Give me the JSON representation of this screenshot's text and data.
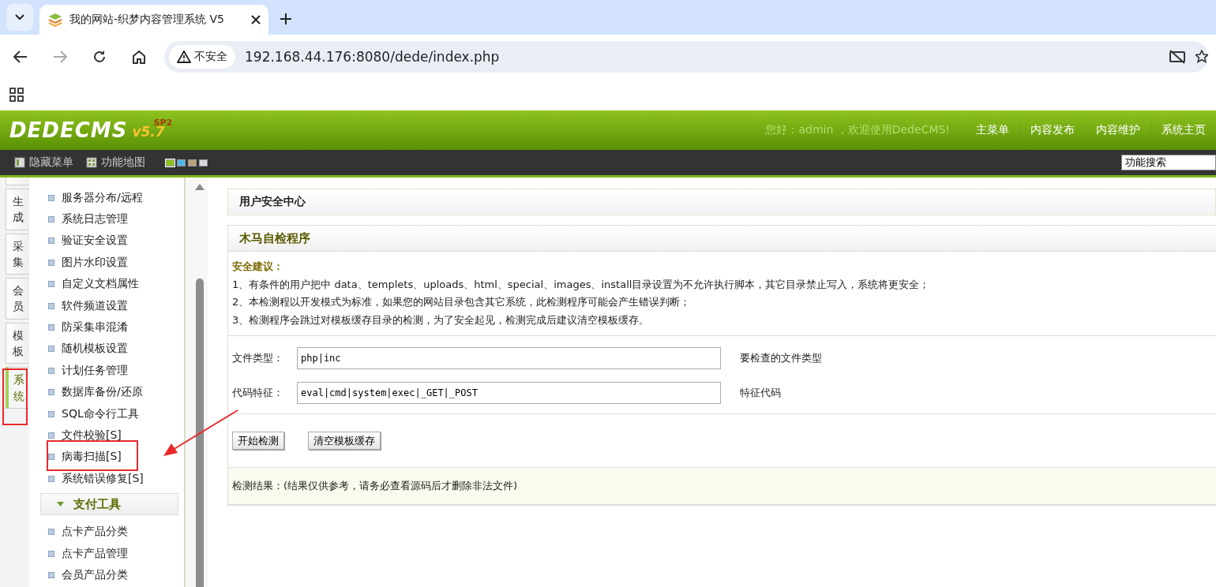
{
  "browser": {
    "tab_title": "我的网站-织梦内容管理系统 V5",
    "security": "不安全",
    "url": "192.168.44.176:8080/dede/index.php"
  },
  "header": {
    "logo": "DEDECMS",
    "version": "v5.7",
    "edition": "SP2",
    "greeting": "您好：admin ，欢迎使用DedeCMS!",
    "nav": [
      "主菜单",
      "内容发布",
      "内容维护",
      "系统主页"
    ]
  },
  "toolbar": {
    "items": [
      "隐藏菜单",
      "功能地图"
    ],
    "skins": [
      {
        "color": "#8fc31f",
        "selected": true
      },
      {
        "color": "#4fb6e3",
        "selected": false
      },
      {
        "color": "#b8a27c",
        "selected": false
      },
      {
        "color": "#d6d9dc",
        "selected": false
      }
    ],
    "search_value": "功能搜索"
  },
  "side_tabs": [
    {
      "label": "生成",
      "selected": false
    },
    {
      "label": "采集",
      "selected": false
    },
    {
      "label": "会员",
      "selected": false
    },
    {
      "label": "模板",
      "selected": false
    },
    {
      "label": "系统",
      "selected": true
    }
  ],
  "menu": {
    "items": [
      "服务器分布/远程",
      "系统日志管理",
      "验证安全设置",
      "图片水印设置",
      "自定义文档属性",
      "软件频道设置",
      "防采集串混淆",
      "随机模板设置",
      "计划任务管理",
      "数据库备份/还原",
      "SQL命令行工具",
      "文件校验[S]",
      "病毒扫描[S]",
      "系统错误修复[S]"
    ],
    "group": {
      "title": "支付工具",
      "expanded": true,
      "items": [
        "点卡产品分类",
        "点卡产品管理",
        "会员产品分类"
      ]
    }
  },
  "main": {
    "title": "用户安全中心",
    "box_title": "木马自检程序",
    "advice_title": "安全建议：",
    "advice": [
      "1、有条件的用户把中 data、templets、uploads、html、special、images、install目录设置为不允许执行脚本，其它目录禁止写入，系统将更安全；",
      "2、本检测程以开发模式为标准，如果您的网站目录包含其它系统，此检测程序可能会产生错误判断；",
      "3、检测程序会跳过对模板缓存目录的检测，为了安全起见，检测完成后建议清空模板缓存。"
    ],
    "fields": [
      {
        "label": "文件类型：",
        "value": "php|inc",
        "hint": "要检查的文件类型"
      },
      {
        "label": "代码特征：",
        "value": "eval|cmd|system|exec|_GET|_POST",
        "hint": "特征代码"
      }
    ],
    "buttons": [
      "开始检测",
      "清空模板缓存"
    ],
    "result": "检测结果：(结果仅供参考，请务必查看源码后才删除非法文件)"
  }
}
